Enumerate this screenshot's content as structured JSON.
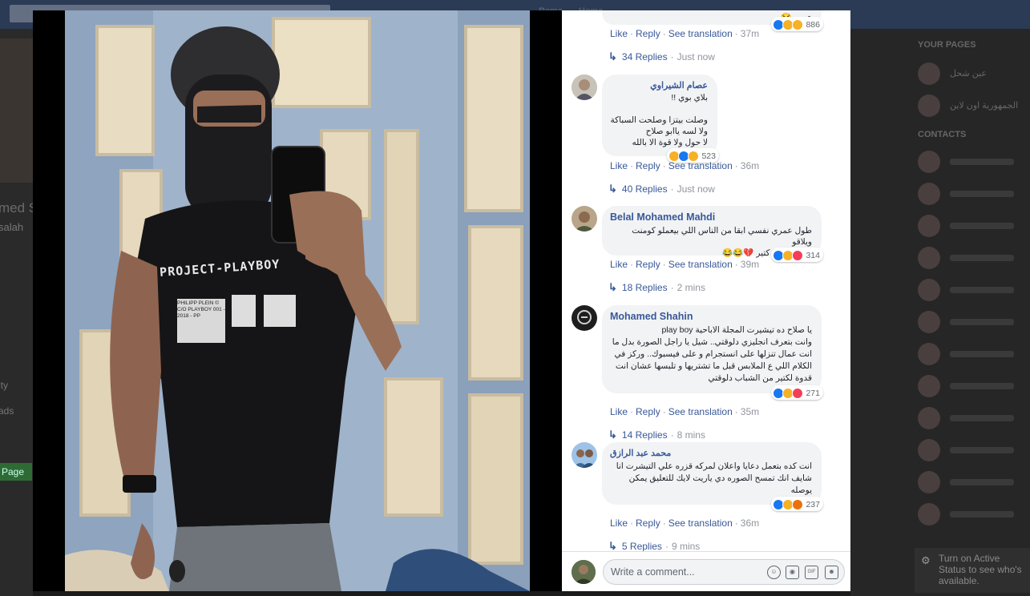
{
  "background": {
    "top_nav": [
      "Rama",
      "Home"
    ],
    "left_fragments": [
      "med S",
      "salah",
      "ity",
      "ads"
    ],
    "left_page_button": "Page",
    "your_pages_header": "YOUR PAGES",
    "your_pages": [
      "عين شحل",
      "الجمهورية اون لاين"
    ],
    "contacts_header": "CONTACTS",
    "active_status": "Turn on Active Status to see who's available."
  },
  "comments": [
    {
      "author": "",
      "text": "عيب 😂",
      "reaction_count": "886",
      "actions": [
        "Like",
        "Reply",
        "See translation"
      ],
      "time": "37m",
      "replies_label": "34 Replies",
      "replies_time": "Just now"
    },
    {
      "author": "عصام الشيراوي",
      "text": "بلاي بوي !!\n\nوصلت بيتزا وصلحت السباكة\nولا لسه ياابو صلاح\nلا حول ولا قوة الا بالله",
      "reaction_count": "523",
      "actions": [
        "Like",
        "Reply",
        "See translation"
      ],
      "time": "36m",
      "replies_label": "40 Replies",
      "replies_time": "Just now"
    },
    {
      "author": "Belal Mohamed Mahdi",
      "text": "طول عمري نفسي ابقا من الناس اللي بيعملو كومنت ويلاقو\nعلية لايكس كتير 💔😂😂",
      "reaction_count": "314",
      "actions": [
        "Like",
        "Reply",
        "See translation"
      ],
      "time": "39m",
      "replies_label": "18 Replies",
      "replies_time": "2 mins"
    },
    {
      "author": "Mohamed Shahin",
      "text": "يا صلاح ده تيشيرت المجلة الاباحية play boy\nوانت بتعرف انجليزي دلوقتي.. شيل يا راجل الصورة بدل ما\nانت عمال تنزلها على انستجرام و على فيسبوك.. وركز في\nالكلام اللي ع الملابس قبل ما تشتريها و تلبسها عشان انت\nقدوة لكتير من الشباب دلوقتي",
      "reaction_count": "271",
      "actions": [
        "Like",
        "Reply",
        "See translation"
      ],
      "time": "35m",
      "replies_label": "14 Replies",
      "replies_time": "8 mins"
    },
    {
      "author": "محمد عبد الرازق",
      "text": "انت كده بتعمل دعايا واعلان لمركه قزره علي التيشرت انا\nشايف انك تمسح الصوره دي ياريت لايك للتعليق يمكن\nيوصله",
      "reaction_count": "237",
      "actions": [
        "Like",
        "Reply",
        "See translation"
      ],
      "time": "36m",
      "replies_label": "5 Replies",
      "replies_time": "9 mins"
    }
  ],
  "composer": {
    "placeholder": "Write a comment...",
    "icons": [
      "emoji-icon",
      "camera-icon",
      "gif-icon",
      "sticker-icon"
    ]
  },
  "photo": {
    "shirt_text": "PROJECT-PLAYBOY",
    "label_text": "PHILIPP PLEIN © C/O PLAYBOY 001 - 2018 - PP"
  },
  "colors": {
    "link": "#385898",
    "bubble": "#f2f3f5",
    "like": "#1877f2",
    "love": "#f33e58",
    "haha": "#f7b125"
  }
}
